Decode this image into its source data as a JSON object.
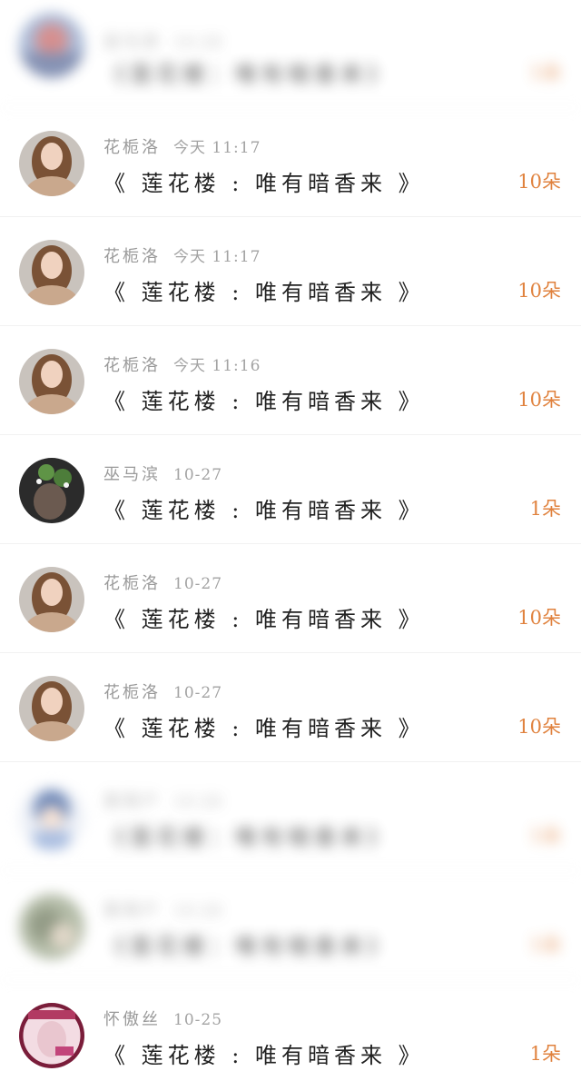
{
  "rows": [
    {
      "name": "巫马滨",
      "time": "10-28",
      "title": "《莲花楼：唯有暗香来》",
      "amount": "1朵",
      "blurred": true
    },
    {
      "name": "花栀洛",
      "time": "今天 11:17",
      "title": "《 莲花楼 : 唯有暗香来 》",
      "amount": "10朵",
      "blurred": false
    },
    {
      "name": "花栀洛",
      "time": "今天 11:17",
      "title": "《 莲花楼 : 唯有暗香来 》",
      "amount": "10朵",
      "blurred": false
    },
    {
      "name": "花栀洛",
      "time": "今天 11:16",
      "title": "《 莲花楼 : 唯有暗香来 》",
      "amount": "10朵",
      "blurred": false
    },
    {
      "name": "巫马滨",
      "time": "10-27",
      "title": "《 莲花楼 : 唯有暗香来 》",
      "amount": "1朵",
      "blurred": false
    },
    {
      "name": "花栀洛",
      "time": "10-27",
      "title": "《 莲花楼 : 唯有暗香来 》",
      "amount": "10朵",
      "blurred": false
    },
    {
      "name": "花栀洛",
      "time": "10-27",
      "title": "《 莲花楼 : 唯有暗香来 》",
      "amount": "10朵",
      "blurred": false
    },
    {
      "name": "某用户",
      "time": "10-26",
      "title": "《莲花楼：唯有暗香来》",
      "amount": "1朵",
      "blurred": true
    },
    {
      "name": "某用户",
      "time": "10-26",
      "title": "《莲花楼：唯有暗香来》",
      "amount": "1朵",
      "blurred": true
    },
    {
      "name": "怀傲丝",
      "time": "10-25",
      "title": "《 莲花楼 : 唯有暗香来 》",
      "amount": "1朵",
      "blurred": false
    }
  ],
  "colors": {
    "amount": "#e0823e",
    "name": "#9a9a9a",
    "title": "#222222",
    "divider": "#f1f1f1"
  },
  "icons": {
    "avatar": "user-avatar-icon"
  }
}
